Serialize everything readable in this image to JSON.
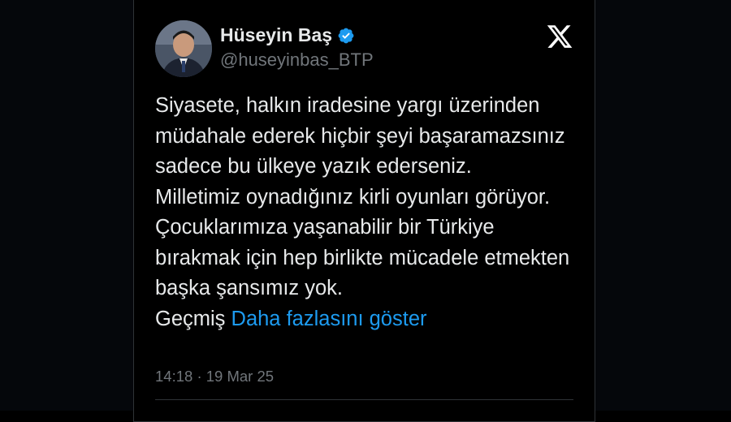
{
  "tweet": {
    "author_name": "Hüseyin Baş",
    "handle": "@huseyinbas_BTP",
    "paragraph_1": "Siyasete, halkın iradesine yargı üzerinden müdahale ederek hiçbir şeyi başaramazsınız sadece bu ülkeye yazık ederseniz.",
    "paragraph_2_lead": "Milletimiz oynadığınız kirli oyunları görüyor. Çocuklarımıza yaşanabilir bir Türkiye bırakmak için hep birlikte mücadele etmekten başka şansımız yok.",
    "paragraph_2_tail": "Geçmiş",
    "show_more": "Daha fazlasını göster",
    "time": "14:18",
    "separator": "·",
    "date": "19 Mar 25"
  },
  "icons": {
    "verified": "verified-badge-icon",
    "platform": "x-logo-icon"
  },
  "colors": {
    "background": "#000000",
    "text": "#e7e9ea",
    "secondary": "#71767b",
    "link": "#1d9bf0",
    "verified": "#1d9bf0"
  }
}
